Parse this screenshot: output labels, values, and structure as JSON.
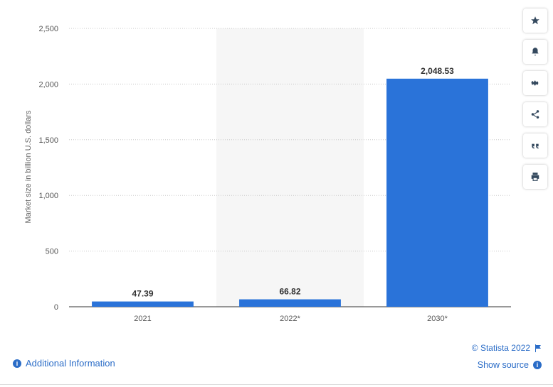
{
  "chart_data": {
    "type": "bar",
    "categories": [
      "2021",
      "2022*",
      "2030*"
    ],
    "values": [
      47.39,
      66.82,
      2048.53
    ],
    "value_labels": [
      "47.39",
      "66.82",
      "2,048.53"
    ],
    "ylabel": "Market size in billion U.S. dollars",
    "ylim": [
      0,
      2500
    ],
    "yticks": [
      0,
      500,
      1000,
      1500,
      2000,
      2500
    ],
    "ytick_labels": [
      "0",
      "500",
      "1,000",
      "1,500",
      "2,000",
      "2,500"
    ],
    "grid": true,
    "highlighted_category": "2022*",
    "bar_color": "#2a73d9",
    "highlight_band_color": "#f6f6f6"
  },
  "side_buttons": [
    {
      "name": "star-icon"
    },
    {
      "name": "bell-icon"
    },
    {
      "name": "gear-icon"
    },
    {
      "name": "share-icon"
    },
    {
      "name": "quote-icon"
    },
    {
      "name": "print-icon"
    }
  ],
  "footer": {
    "additional_info": "Additional Information",
    "credit": "© Statista 2022",
    "show_source": "Show source"
  }
}
